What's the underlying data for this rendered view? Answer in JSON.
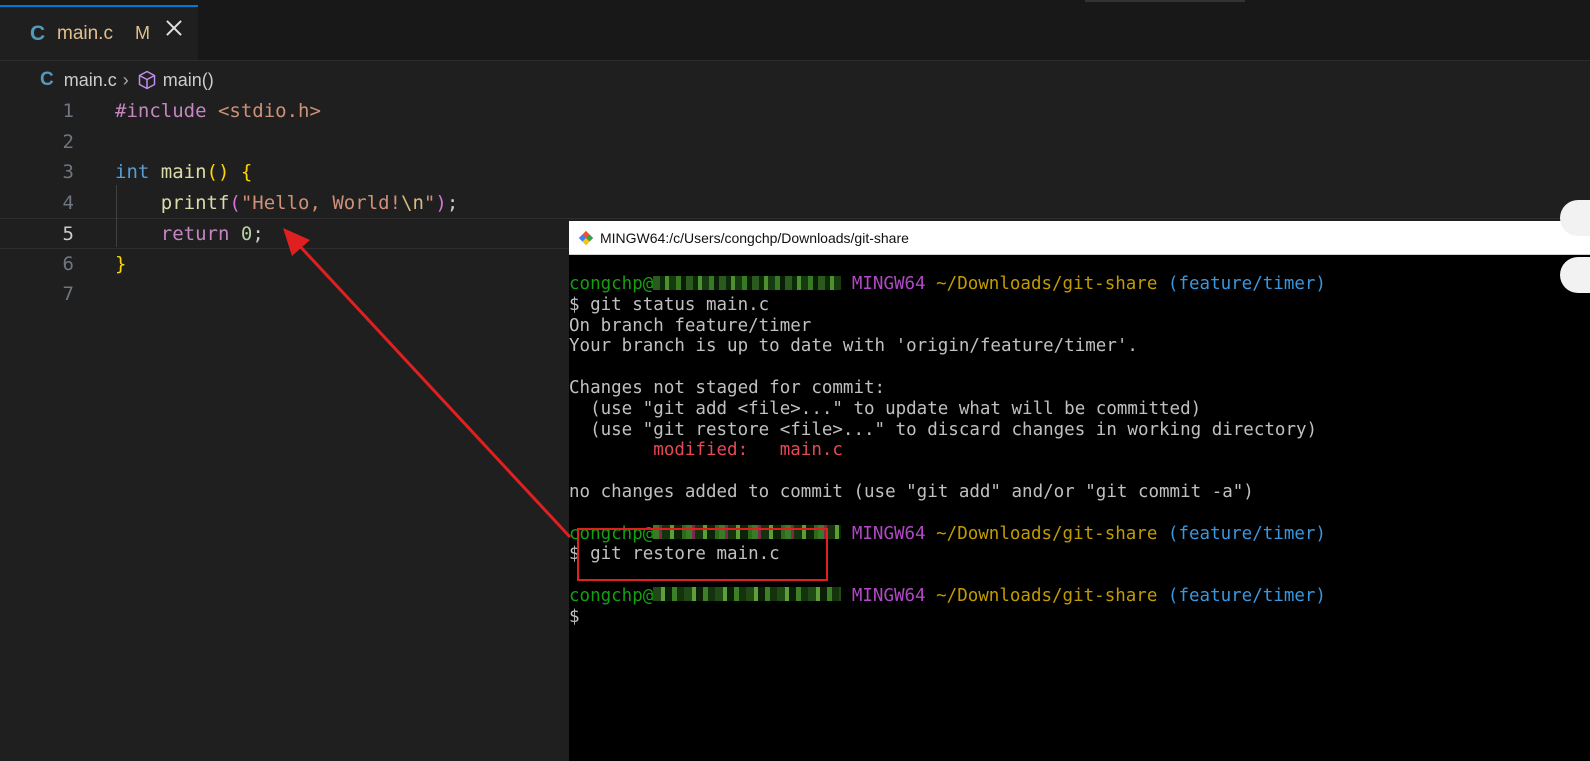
{
  "editor": {
    "tab": {
      "icon_letter": "C",
      "filename": "main.c",
      "status": "M"
    },
    "breadcrumb": {
      "icon_letter": "C",
      "file": "main.c",
      "symbol": "main()"
    },
    "lines": [
      {
        "num": "1",
        "tokens": [
          {
            "t": "#include",
            "c": "k-inc"
          },
          {
            "t": " ",
            "c": "k-pl"
          },
          {
            "t": "<stdio.h>",
            "c": "k-str"
          }
        ]
      },
      {
        "num": "2",
        "tokens": []
      },
      {
        "num": "3",
        "tokens": [
          {
            "t": "int",
            "c": "k-type"
          },
          {
            "t": " ",
            "c": "k-pl"
          },
          {
            "t": "main",
            "c": "k-fn"
          },
          {
            "t": "()",
            "c": "k-br"
          },
          {
            "t": " ",
            "c": "k-pl"
          },
          {
            "t": "{",
            "c": "k-br"
          }
        ]
      },
      {
        "num": "4",
        "tokens": [
          {
            "t": "    ",
            "c": "k-pl"
          },
          {
            "t": "printf",
            "c": "k-fn"
          },
          {
            "t": "(",
            "c": "k-br2"
          },
          {
            "t": "\"Hello, World!",
            "c": "k-str"
          },
          {
            "t": "\\n",
            "c": "k-esc"
          },
          {
            "t": "\"",
            "c": "k-str"
          },
          {
            "t": ")",
            "c": "k-br2"
          },
          {
            "t": ";",
            "c": "k-pl"
          }
        ]
      },
      {
        "num": "5",
        "active": true,
        "tokens": [
          {
            "t": "    ",
            "c": "k-pl"
          },
          {
            "t": "return",
            "c": "k-kw"
          },
          {
            "t": " ",
            "c": "k-pl"
          },
          {
            "t": "0",
            "c": "k-num"
          },
          {
            "t": ";",
            "c": "k-pl"
          }
        ]
      },
      {
        "num": "6",
        "tokens": [
          {
            "t": "}",
            "c": "k-br"
          }
        ]
      },
      {
        "num": "7",
        "tokens": []
      }
    ]
  },
  "terminal": {
    "title": "MINGW64:/c/Users/congchp/Downloads/git-share",
    "lines": [
      {
        "segs": [
          {
            "t": "congchp@",
            "c": "t-green"
          },
          {
            "blur": "b1"
          },
          {
            "t": " MINGW64",
            "c": "t-mag"
          },
          {
            "t": " ~/Downloads/git-share",
            "c": "t-yel"
          },
          {
            "t": " (feature/timer)",
            "c": "t-cyan"
          }
        ]
      },
      {
        "segs": [
          {
            "t": "$ git status main.c"
          }
        ]
      },
      {
        "segs": [
          {
            "t": "On branch feature/timer"
          }
        ]
      },
      {
        "segs": [
          {
            "t": "Your branch is up to date with 'origin/feature/timer'."
          }
        ]
      },
      {
        "segs": []
      },
      {
        "segs": [
          {
            "t": "Changes not staged for commit:"
          }
        ]
      },
      {
        "segs": [
          {
            "t": "  (use \"git add <file>...\" to update what will be committed)"
          }
        ]
      },
      {
        "segs": [
          {
            "t": "  (use \"git restore <file>...\" to discard changes in working directory)"
          }
        ]
      },
      {
        "segs": [
          {
            "t": "        modified:   main.c",
            "c": "t-red"
          }
        ]
      },
      {
        "segs": []
      },
      {
        "segs": [
          {
            "t": "no changes added to commit (use \"git add\" and/or \"git commit -a\")"
          }
        ]
      },
      {
        "segs": []
      },
      {
        "segs": [
          {
            "t": "congchp@",
            "c": "t-green"
          },
          {
            "blur": "b2"
          },
          {
            "t": " MINGW64",
            "c": "t-mag"
          },
          {
            "t": " ~/Downloads/git-share",
            "c": "t-yel"
          },
          {
            "t": " (feature/timer)",
            "c": "t-cyan"
          }
        ]
      },
      {
        "segs": [
          {
            "t": "$ git restore main.c"
          }
        ]
      },
      {
        "segs": []
      },
      {
        "segs": [
          {
            "t": "congchp@",
            "c": "t-green"
          },
          {
            "blur": "b3"
          },
          {
            "t": " MINGW64",
            "c": "t-mag"
          },
          {
            "t": " ~/Downloads/git-share",
            "c": "t-yel"
          },
          {
            "t": " (feature/timer)",
            "c": "t-cyan"
          }
        ]
      },
      {
        "segs": [
          {
            "t": "$"
          }
        ]
      }
    ]
  },
  "colors": {
    "annotation": "#e02020",
    "tab_accent": "#0078d4"
  }
}
